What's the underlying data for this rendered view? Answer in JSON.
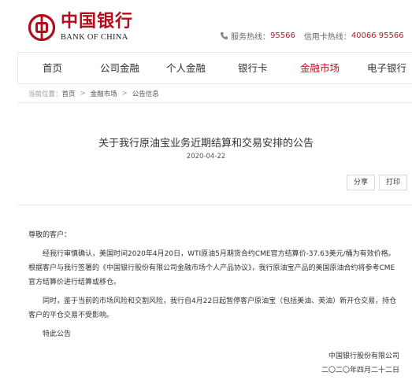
{
  "header": {
    "logo_cn": "中国银行",
    "logo_en": "BANK OF CHINA",
    "hotline_label": "服务热线：",
    "hotline_number": "95566",
    "card_hotline_label": "信用卡热线：",
    "card_hotline_number": "40066 95566",
    "brand_color": "#b20d1d",
    "accent_color": "#c8102e"
  },
  "nav": {
    "items": [
      {
        "label": "首页"
      },
      {
        "label": "公司金融"
      },
      {
        "label": "个人金融"
      },
      {
        "label": "银行卡"
      },
      {
        "label": "金融市场"
      },
      {
        "label": "电子银行"
      }
    ],
    "active": "金融市场"
  },
  "breadcrumb": {
    "prefix": "当前位置：",
    "items": [
      "首页",
      "金融市场",
      "公告信息"
    ],
    "separator": ">"
  },
  "article": {
    "title": "关于我行原油宝业务近期结算和交易安排的公告",
    "date": "2020-04-22",
    "share_label": "分享",
    "print_label": "打印",
    "greeting": "尊敬的客户：",
    "paragraphs": [
      "经我行审慎确认，美国时间2020年4月20日，WTI原油5月期货合约CME官方结算价-37.63美元/桶为有效价格。根据客户与我行签署的《中国银行股份有限公司金融市场个人产品协议》，我行原油宝产品的美国原油合约将参考CME官方结算价进行结算或移仓。",
      "同时，鉴于当前的市场风险和交割风险，我行自4月22日起暂停客户原油宝（包括美油、英油）新开仓交易，持仓客户的平仓交易不受影响。"
    ],
    "closing": "特此公告",
    "signature_org": "中国银行股份有限公司",
    "signature_date": "二〇二〇年四月二十二日"
  }
}
